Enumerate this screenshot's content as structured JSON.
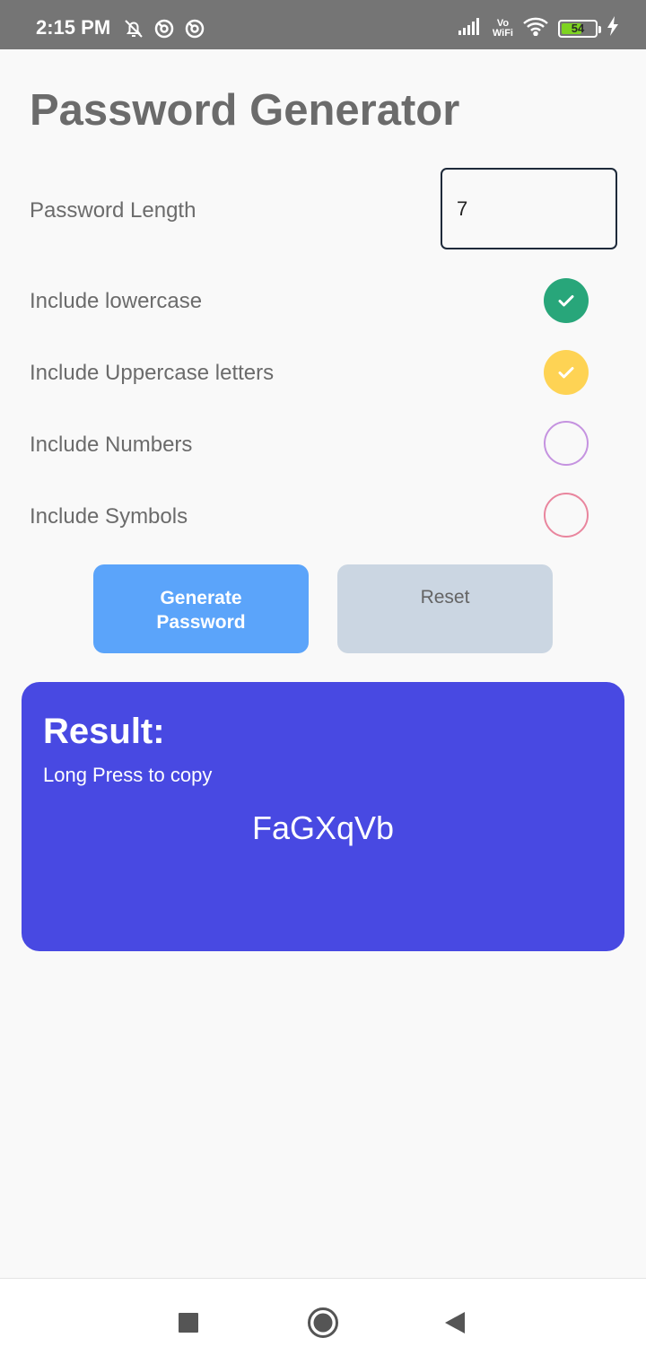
{
  "status_bar": {
    "time": "2:15 PM",
    "left_icons": [
      "alarm-off-icon",
      "data-saver-icon",
      "data-saver-icon"
    ],
    "right_icons": [
      "signal-icon",
      "vowifi-icon",
      "wifi-icon",
      "battery-icon",
      "charging-icon"
    ],
    "vowifi_top": "Vo",
    "vowifi_bottom": "WiFi",
    "battery_level": "54"
  },
  "page": {
    "title": "Password Generator"
  },
  "length": {
    "label": "Password Length",
    "value": "7"
  },
  "options": [
    {
      "label": "Include lowercase",
      "checked": true,
      "color": "#28a67a"
    },
    {
      "label": "Include Uppercase letters",
      "checked": true,
      "color": "#fed354"
    },
    {
      "label": "Include Numbers",
      "checked": false,
      "color": "#c593e0"
    },
    {
      "label": "Include Symbols",
      "checked": false,
      "color": "#e9869e"
    }
  ],
  "buttons": {
    "generate": "Generate Password",
    "reset": "Reset"
  },
  "result": {
    "title": "Result:",
    "hint": "Long Press to copy",
    "password": "FaGXqVb",
    "background": "#4849e2"
  },
  "nav_bar": {
    "icons": [
      "recents-square-icon",
      "home-circle-icon",
      "back-triangle-icon"
    ]
  }
}
